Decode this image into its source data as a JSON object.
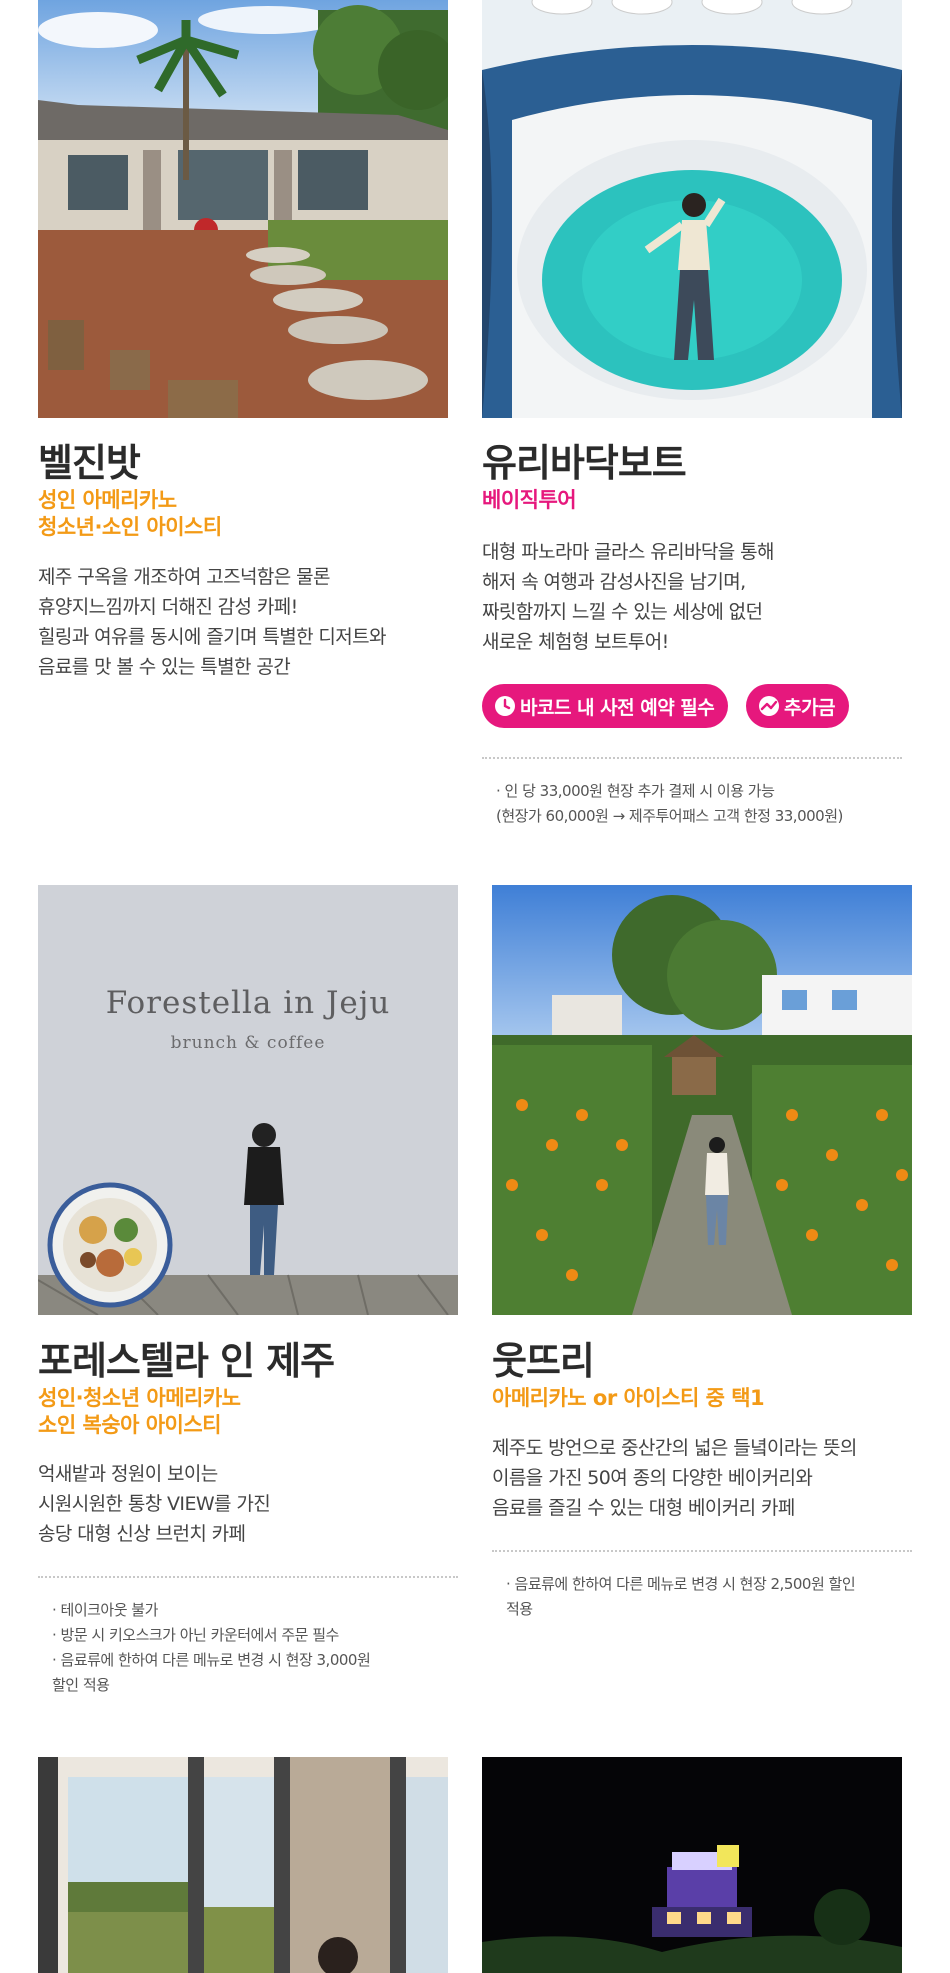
{
  "cards": [
    {
      "title": "벨진밧",
      "sub": [
        "성인 아메리카노",
        "청소년·소인 아이스티"
      ],
      "desc": [
        "제주 구옥을 개조하여 고즈넉함은 물론",
        "휴양지느낌까지 더해진 감성 카페!",
        "힐링과 여유를 동시에 즐기며 특별한 디저트와",
        "음료를 맛 볼 수 있는 특별한 공간"
      ]
    },
    {
      "title": "유리바닥보트",
      "sub": [
        "베이직투어"
      ],
      "desc": [
        "대형 파노라마 글라스 유리바닥을 통해",
        "해저 속 여행과 감성사진을 남기며,",
        "짜릿함까지 느낄 수 있는 세상에 없던",
        "새로운 체험형 보트투어!"
      ],
      "badges": [
        {
          "label": "바코드 내 사전 예약 필수",
          "icon": "clock-icon"
        },
        {
          "label": "추가금",
          "icon": "trend-icon"
        }
      ],
      "notes": [
        "· 인 당 33,000원 현장 추가 결제 시 이용 가능",
        "(현장가 60,000원 → 제주투어패스 고객 한정 33,000원)"
      ]
    },
    {
      "title": "포레스텔라 인 제주",
      "sub": [
        "성인·청소년 아메리카노",
        "소인 복숭아 아이스티"
      ],
      "desc": [
        "억새밭과 정원이 보이는",
        "시원시원한 통창 VIEW를 가진",
        "송당 대형 신상 브런치 카페"
      ],
      "notes": [
        "· 테이크아웃 불가",
        "· 방문 시 키오스크가 아닌 카운터에서 주문 필수",
        "· 음료류에 한하여 다른 메뉴로 변경 시 현장 3,000원",
        "  할인 적용"
      ],
      "photo_text": {
        "line1": "Forestella in Jeju",
        "line2": "brunch & coffee"
      }
    },
    {
      "title": "웃뜨리",
      "sub": [
        "아메리카노 or 아이스티 중 택1"
      ],
      "desc": [
        "제주도 방언으로 중산간의 넓은 들녘이라는 뜻의",
        "이름을 가진 50여 종의 다양한 베이커리와",
        "음료를 즐길 수 있는 대형 베이커리 카페"
      ],
      "notes": [
        "· 음료류에 한하여 다른 메뉴로 변경 시 현장 2,500원 할인",
        "  적용"
      ]
    }
  ],
  "colors": {
    "orange": "#f39a16",
    "pink": "#e6187d"
  }
}
